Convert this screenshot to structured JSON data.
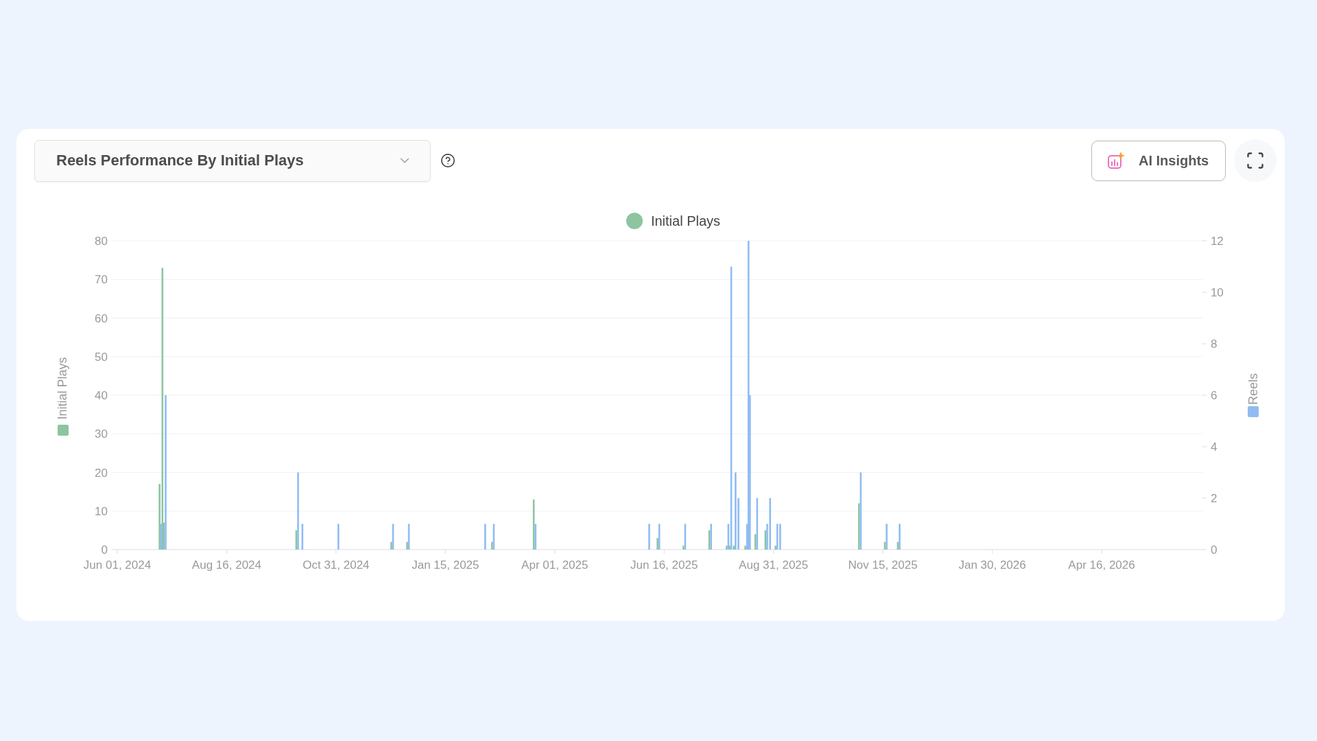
{
  "header": {
    "report_select": {
      "value": "Reels Performance By Initial Plays"
    },
    "ai_button": {
      "label": "AI Insights"
    }
  },
  "chart": {
    "chart_data": {
      "type": "bar",
      "grid": true,
      "ylabel": "Initial Plays",
      "y2label": "Reels",
      "x": [
        "2024-07-01",
        "2024-07-03",
        "2024-07-04",
        "2024-10-04",
        "2024-10-07",
        "2024-11-01",
        "2024-12-09",
        "2024-12-20",
        "2025-02-11",
        "2025-02-17",
        "2025-03-18",
        "2025-06-05",
        "2025-06-12",
        "2025-06-30",
        "2025-07-18",
        "2025-07-30",
        "2025-08-01",
        "2025-08-04",
        "2025-08-06",
        "2025-08-12",
        "2025-08-13",
        "2025-08-14",
        "2025-08-19",
        "2025-08-26",
        "2025-08-28",
        "2025-09-02",
        "2025-09-04",
        "2025-10-30",
        "2025-11-17",
        "2025-11-26"
      ],
      "series": [
        {
          "name": "Initial Plays",
          "color": "#8cc5a0",
          "values": [
            17,
            73,
            7,
            5,
            0,
            0,
            2,
            2,
            0,
            2,
            13,
            0,
            3,
            1,
            5,
            1,
            1,
            1,
            null,
            1,
            0,
            0,
            4,
            5,
            null,
            1,
            0,
            12,
            2,
            2
          ]
        },
        {
          "color": "#90bcf2",
          "axis": "y2",
          "values": [
            1,
            0,
            6,
            3,
            1,
            1,
            1,
            1,
            1,
            1,
            1,
            1,
            1,
            1,
            1,
            1,
            11,
            3,
            2,
            1,
            12,
            6,
            2,
            1,
            2,
            1,
            1,
            3,
            1,
            1
          ]
        }
      ],
      "xlim": [
        "2024-05-28",
        "2026-06-25"
      ],
      "ylim": [
        0,
        80
      ],
      "y2lim": [
        0,
        12
      ],
      "xticks": [
        {
          "value": "2024-06-01",
          "label": "Jun 01, 2024"
        },
        {
          "value": "2024-08-16",
          "label": "Aug 16, 2024"
        },
        {
          "value": "2024-10-31",
          "label": "Oct 31, 2024"
        },
        {
          "value": "2025-01-15",
          "label": "Jan 15, 2025"
        },
        {
          "value": "2025-04-01",
          "label": "Apr 01, 2025"
        },
        {
          "value": "2025-06-16",
          "label": "Jun 16, 2025"
        },
        {
          "value": "2025-08-31",
          "label": "Aug 31, 2025"
        },
        {
          "value": "2025-11-15",
          "label": "Nov 15, 2025"
        },
        {
          "value": "2026-01-30",
          "label": "Jan 30, 2026"
        },
        {
          "value": "2026-04-16",
          "label": "Apr 16, 2026"
        }
      ],
      "yticks": [
        0,
        10,
        20,
        30,
        40,
        50,
        60,
        70,
        80
      ],
      "y2ticks": [
        0,
        2,
        4,
        6,
        8,
        10,
        12
      ]
    }
  }
}
